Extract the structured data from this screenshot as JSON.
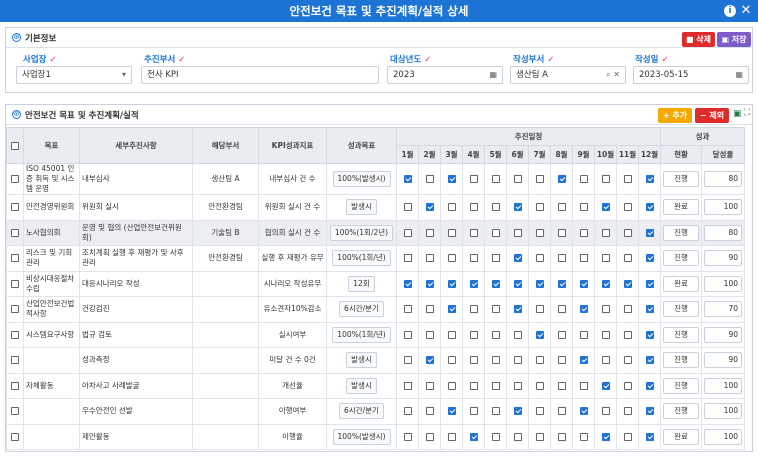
{
  "title": "안전보건 목표 및 추진계획/실적 상세",
  "basic": {
    "section_title": "기본정보",
    "delete_label": "삭제",
    "save_label": "저장",
    "fields": {
      "site": {
        "label": "사업장",
        "value": "사업장1"
      },
      "dept": {
        "label": "추진부서",
        "value": "전사 KPI"
      },
      "year": {
        "label": "대상년도",
        "value": "2023"
      },
      "writer_dept": {
        "label": "작성부서",
        "value": "생산팀 A"
      },
      "date": {
        "label": "작성일",
        "value": "2023-05-15"
      }
    }
  },
  "plan": {
    "section_title": "안전보건 목표 및 추진계획/실적",
    "add_label": "추가",
    "remove_label": "제외",
    "headers": {
      "goal": "목표",
      "detail": "세부추진사항",
      "dept": "해당부서",
      "kpi": "KPI성과지표",
      "target": "성과목표",
      "schedule": "추진일정",
      "perf": "성과",
      "status": "현황",
      "rate": "달성율",
      "months": [
        "1월",
        "2월",
        "3월",
        "4월",
        "5월",
        "6월",
        "7월",
        "8월",
        "9월",
        "10월",
        "11월",
        "12월"
      ]
    },
    "rows": [
      {
        "goal": "ISO 45001 인증 취득 및 시스템 운영",
        "detail": "내부심사",
        "dept": "생산팀 A",
        "kpi": "내부심사 건 수",
        "target": "100%(발생시)",
        "months": [
          1,
          0,
          1,
          0,
          0,
          0,
          0,
          1,
          0,
          0,
          0,
          1
        ],
        "status": "진행",
        "rate": "80"
      },
      {
        "goal": "안전경영위원회",
        "detail": "위원회 실시",
        "dept": "안전환경팀",
        "kpi": "위원회 실시 건 수",
        "target": "발생시",
        "months": [
          0,
          1,
          0,
          0,
          0,
          1,
          0,
          0,
          0,
          1,
          0,
          1
        ],
        "status": "완료",
        "rate": "100"
      },
      {
        "goal": "노사협의회",
        "detail": "운영 및 협의 (산업안전보건위원회)",
        "dept": "기술팀 B",
        "kpi": "협의회 실시 건 수",
        "target": "100%(1회/2년)",
        "months": [
          0,
          0,
          0,
          0,
          0,
          0,
          0,
          0,
          0,
          0,
          0,
          1
        ],
        "status": "진행",
        "rate": "80"
      },
      {
        "goal": "리스크 및 기회관리",
        "detail": "조치계획 실행 후 재평가 및 사후관리",
        "dept": "안전환경팀",
        "kpi": "실행 후 재평가 유무",
        "target": "100%(1회/년)",
        "months": [
          0,
          0,
          0,
          0,
          0,
          1,
          0,
          0,
          0,
          0,
          0,
          1
        ],
        "status": "진행",
        "rate": "90"
      },
      {
        "goal": "비상시대응절차 수립",
        "detail": "대응시나리오 작성",
        "dept": "",
        "kpi": "시나리오 작성유무",
        "target": "12회",
        "months": [
          1,
          1,
          1,
          1,
          1,
          1,
          1,
          1,
          1,
          1,
          1,
          1
        ],
        "status": "완료",
        "rate": "100"
      },
      {
        "goal": "산업안전보건법적사항",
        "detail": "건강검진",
        "dept": "",
        "kpi": "유소견자10%감소",
        "target": "6시간/분기",
        "months": [
          0,
          0,
          1,
          0,
          0,
          1,
          0,
          0,
          1,
          0,
          0,
          1
        ],
        "status": "진행",
        "rate": "70"
      },
      {
        "goal": "시스템요구사항",
        "detail": "법규 검토",
        "dept": "",
        "kpi": "실시여부",
        "target": "100%(1회/년)",
        "months": [
          0,
          0,
          0,
          0,
          0,
          0,
          1,
          0,
          0,
          0,
          0,
          1
        ],
        "status": "진행",
        "rate": "90"
      },
      {
        "goal": "",
        "detail": "성과측정",
        "dept": "",
        "kpi": "미달 건 수 0건",
        "target": "발생시",
        "months": [
          0,
          1,
          0,
          0,
          0,
          0,
          0,
          0,
          1,
          0,
          0,
          1
        ],
        "status": "진행",
        "rate": "90"
      },
      {
        "goal": "자체활동",
        "detail": "아차사고 사례발굴",
        "dept": "",
        "kpi": "개선율",
        "target": "발생시",
        "months": [
          0,
          0,
          0,
          0,
          0,
          0,
          0,
          0,
          0,
          1,
          0,
          1
        ],
        "status": "진행",
        "rate": "100"
      },
      {
        "goal": "",
        "detail": "우수안전인 선발",
        "dept": "",
        "kpi": "이행여부",
        "target": "6시간/분기",
        "months": [
          0,
          0,
          1,
          0,
          0,
          1,
          0,
          0,
          1,
          0,
          0,
          1
        ],
        "status": "진행",
        "rate": "100"
      },
      {
        "goal": "",
        "detail": "제안활동",
        "dept": "",
        "kpi": "이행율",
        "target": "100%(발생시)",
        "months": [
          0,
          0,
          0,
          1,
          0,
          0,
          0,
          0,
          0,
          1,
          0,
          1
        ],
        "status": "완료",
        "rate": "100"
      }
    ]
  }
}
